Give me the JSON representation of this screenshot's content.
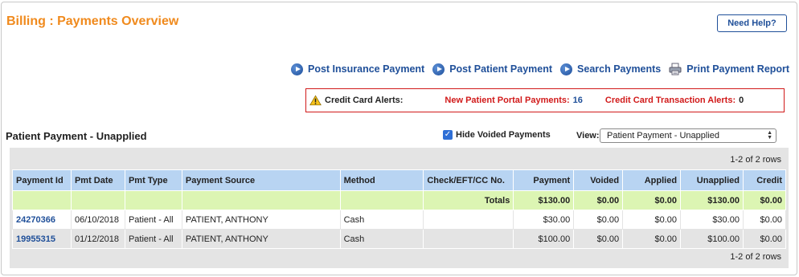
{
  "page": {
    "title": "Billing : Payments Overview"
  },
  "help_button": {
    "label": "Need Help?"
  },
  "actions": [
    {
      "label": "Post Insurance Payment",
      "icon": "play-circle-icon"
    },
    {
      "label": "Post Patient Payment",
      "icon": "play-circle-icon"
    },
    {
      "label": "Search Payments",
      "icon": "play-circle-icon"
    },
    {
      "label": "Print Payment Report",
      "icon": "printer-icon"
    }
  ],
  "alerts": {
    "label": "Credit Card Alerts:",
    "portal_label": "New Patient Portal Payments:",
    "portal_count": "16",
    "transaction_label": "Credit Card Transaction Alerts:",
    "transaction_count": "0",
    "colors": {
      "border": "#d11a1a",
      "alert_text": "#d11a1a",
      "link": "#1f4f99"
    }
  },
  "section": {
    "title": "Patient Payment - Unapplied"
  },
  "filters": {
    "hide_voided_label": "Hide Voided Payments",
    "hide_voided_checked": true,
    "view_label": "View:",
    "view_value": "Patient Payment - Unapplied"
  },
  "grid": {
    "row_count_text": "1-2 of 2 rows",
    "columns": [
      "Payment Id",
      "Pmt Date",
      "Pmt Type",
      "Payment Source",
      "Method",
      "Check/EFT/CC No.",
      "Payment",
      "Voided",
      "Applied",
      "Unapplied",
      "Credit"
    ],
    "totals": {
      "label": "Totals",
      "payment": "$130.00",
      "voided": "$0.00",
      "applied": "$0.00",
      "unapplied": "$130.00",
      "credit": "$0.00"
    },
    "rows": [
      {
        "payment_id": "24270366",
        "date": "06/10/2018",
        "type": "Patient - All",
        "source": "PATIENT, ANTHONY",
        "method": "Cash",
        "check_no": "",
        "payment": "$30.00",
        "voided": "$0.00",
        "applied": "$0.00",
        "unapplied": "$30.00",
        "credit": "$0.00"
      },
      {
        "payment_id": "19955315",
        "date": "01/12/2018",
        "type": "Patient - All",
        "source": "PATIENT, ANTHONY",
        "method": "Cash",
        "check_no": "",
        "payment": "$100.00",
        "voided": "$0.00",
        "applied": "$0.00",
        "unapplied": "$100.00",
        "credit": "$0.00"
      }
    ],
    "colors": {
      "header_bg": "#b8d4f2",
      "totals_bg": "#dcf5b3",
      "row_alt_bg": "#e4e4e4"
    }
  },
  "theme": {
    "title_color": "#f08a1d",
    "link_color": "#1f4f99"
  }
}
